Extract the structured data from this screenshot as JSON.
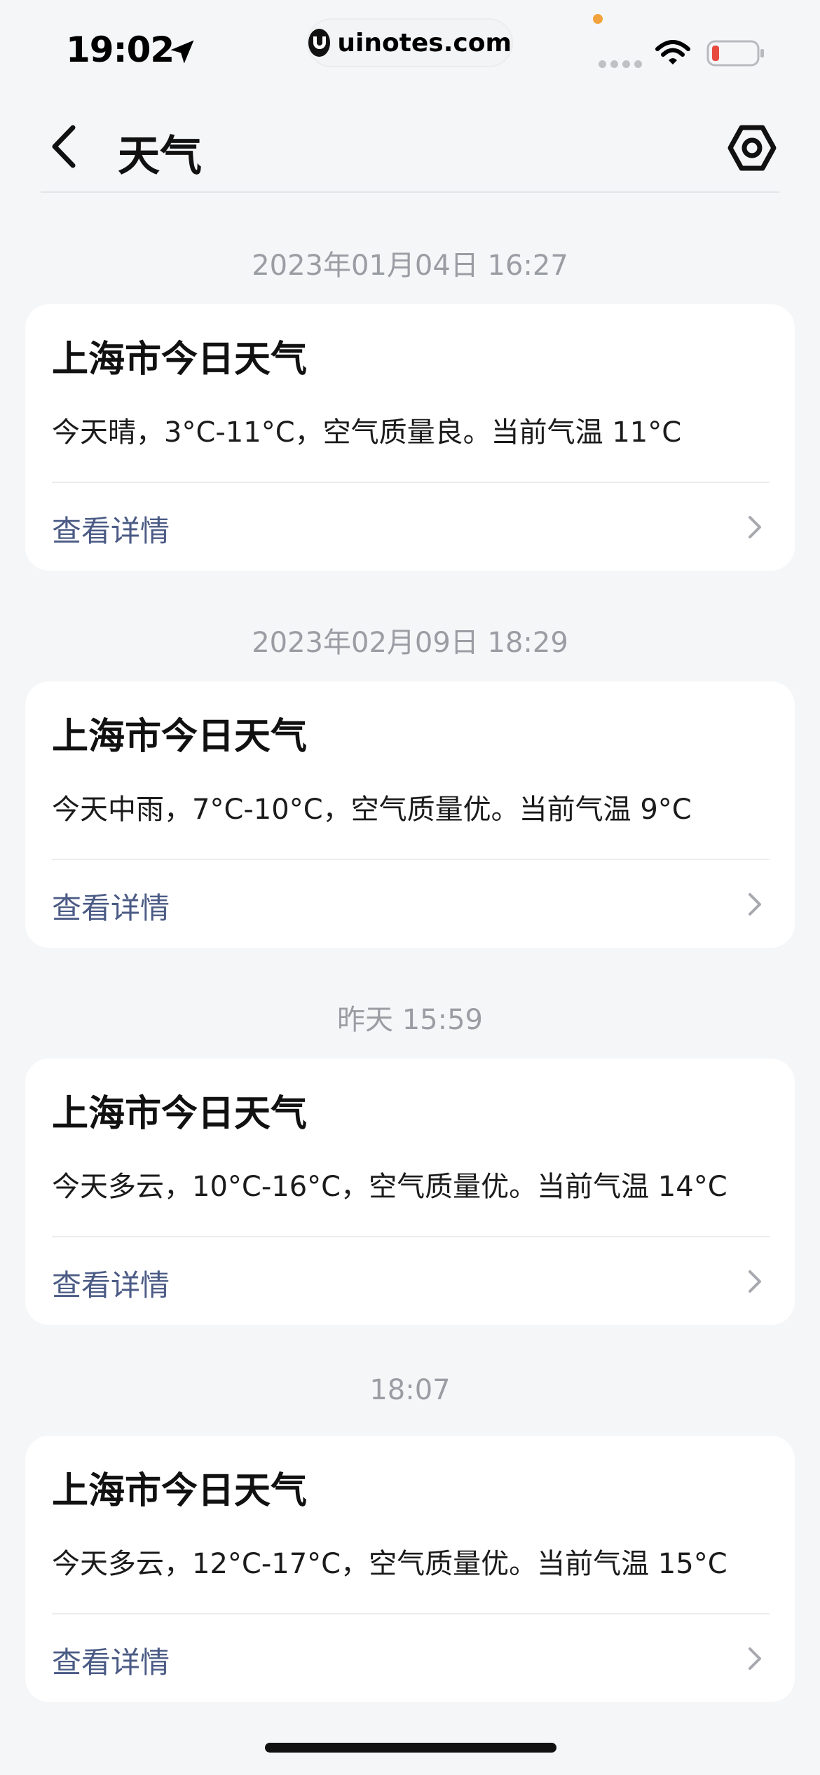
{
  "status_bar": {
    "time": "19:02",
    "url": "uinotes.com",
    "icons": [
      "location-arrow-icon",
      "site-logo-icon",
      "signal-icon",
      "wifi-icon",
      "battery-icon"
    ],
    "battery_level": 0.15,
    "colors": {
      "battery_low": "#e84a3f",
      "mic_indicator": "#f2a23a"
    }
  },
  "nav": {
    "title": "天气",
    "back_icon": "chevron-left-icon",
    "settings_icon": "settings-hexagon-icon"
  },
  "feed": [
    {
      "timestamp": "2023年01月04日 16:27",
      "title": "上海市今日天气",
      "body": "今天晴，3°C-11°C，空气质量良。当前气温 11°C",
      "link": "查看详情"
    },
    {
      "timestamp": "2023年02月09日 18:29",
      "title": "上海市今日天气",
      "body": "今天中雨，7°C-10°C，空气质量优。当前气温 9°C",
      "link": "查看详情"
    },
    {
      "timestamp": "昨天 15:59",
      "title": "上海市今日天气",
      "body": "今天多云，10°C-16°C，空气质量优。当前气温 14°C",
      "link": "查看详情"
    },
    {
      "timestamp": "18:07",
      "title": "上海市今日天气",
      "body": "今天多云，12°C-17°C，空气质量优。当前气温 15°C",
      "link": "查看详情"
    }
  ],
  "colors": {
    "background": "#f5f6f8",
    "card": "#ffffff",
    "link": "#4b5b85",
    "timestamp": "#9a9da3"
  }
}
